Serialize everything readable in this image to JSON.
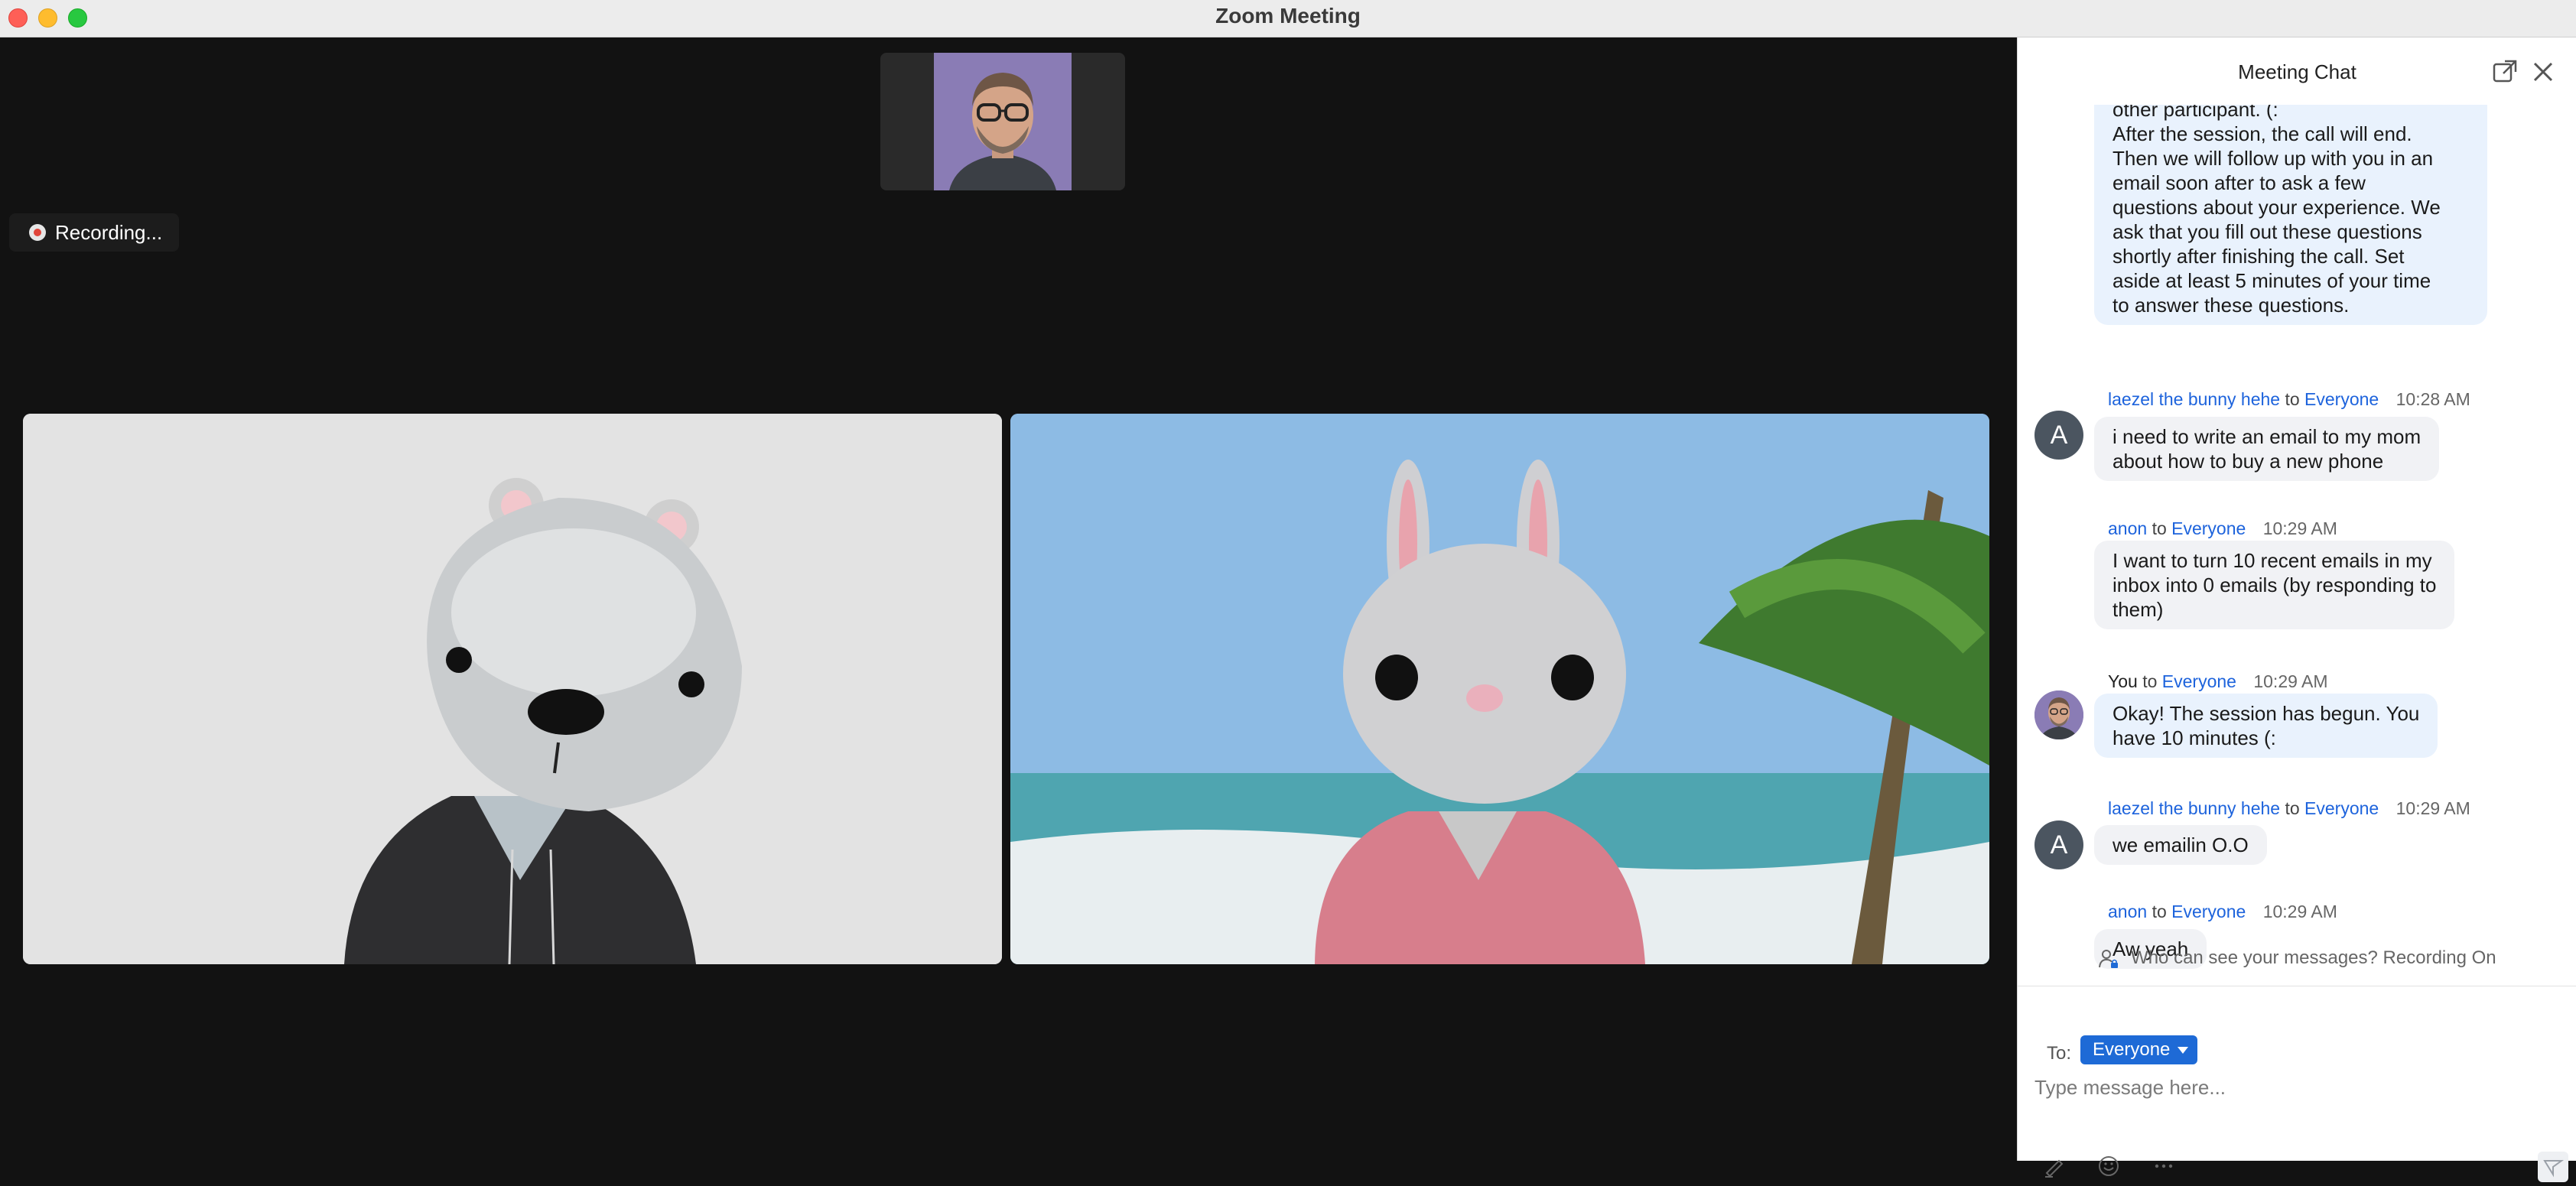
{
  "window": {
    "title": "Zoom Meeting"
  },
  "meeting": {
    "recording_label": "Recording..."
  },
  "chat": {
    "title": "Meeting Chat",
    "messages": [
      {
        "sender": "",
        "text_lines": [
          "other participant. (:",
          "After the session, the call will end.",
          "Then we will follow up with you in an",
          "email soon after to ask a few",
          "questions about your experience. We",
          "ask that you fill out these questions",
          "shortly after finishing the call. Set",
          "aside at least 5 minutes of your time",
          "to answer these questions."
        ]
      },
      {
        "sender": "laezel the bunny hehe",
        "to_word": "to",
        "target": "Everyone",
        "time": "10:28 AM",
        "avatar_letter": "A",
        "text_lines": [
          "i need to write an email to my mom",
          "about how to buy a new phone"
        ]
      },
      {
        "sender": "anon",
        "to_word": "to",
        "target": "Everyone",
        "time": "10:29 AM",
        "text_lines": [
          "I want to turn 10 recent emails in my",
          "inbox into 0 emails (by responding to",
          "them)"
        ]
      },
      {
        "sender": "You",
        "to_word": "to",
        "target": "Everyone",
        "time": "10:29 AM",
        "text_lines": [
          "Okay! The session has begun. You",
          "have 10 minutes (:"
        ]
      },
      {
        "sender": "laezel the bunny hehe",
        "to_word": "to",
        "target": "Everyone",
        "time": "10:29 AM",
        "avatar_letter": "A",
        "text_lines": [
          "we emailin O.O"
        ]
      },
      {
        "sender": "anon",
        "to_word": "to",
        "target": "Everyone",
        "time": "10:29 AM",
        "text_lines": [
          "Aw yeah"
        ]
      }
    ],
    "privacy_notice": "Who can see your messages? Recording On",
    "composer": {
      "to_label": "To:",
      "recipient": "Everyone",
      "placeholder": "Type message here..."
    }
  },
  "icons": {
    "pop_out": "pop-out-icon",
    "close": "close-icon",
    "privacy": "person-lock-icon",
    "format": "format-pen-icon",
    "emoji": "emoji-icon",
    "more": "more-icon",
    "send": "send-icon"
  },
  "colors": {
    "accent": "#1e6ad6",
    "bubble_self": "#e9f2fd",
    "bubble_other": "#f1f2f5",
    "recording_dot": "#e0453a"
  }
}
